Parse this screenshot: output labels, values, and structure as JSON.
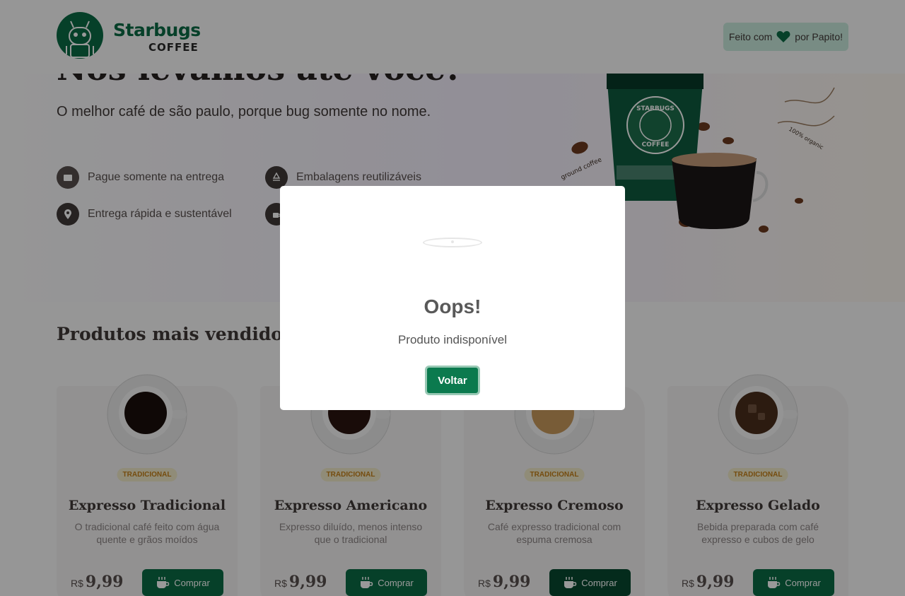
{
  "header": {
    "logo_title": "Starbugs",
    "logo_sub": "COFFEE",
    "made_by_prefix": "Feito com",
    "made_by_suffix": "por Papito!"
  },
  "hero": {
    "title": "Nós levamos até você!",
    "subtitle": "O melhor café de são paulo, porque bug somente no nome.",
    "features": [
      {
        "label": "Pague somente na entrega",
        "icon": "wallet-icon",
        "color": "#574f4d"
      },
      {
        "label": "Embalagens reutilizáveis",
        "icon": "recycle-icon",
        "color": "#403937"
      },
      {
        "label": "Entrega rápida e sustentável",
        "icon": "map-pin-icon",
        "color": "#403937"
      },
      {
        "label": "",
        "icon": "coffee-icon",
        "color": "#403937"
      }
    ],
    "art_labels": {
      "left": "ground coffee",
      "right": "100% organic",
      "cup_line1": "STARBUGS",
      "cup_line2": "COFFEE"
    }
  },
  "products": {
    "title": "Produtos mais vendidos",
    "currency": "R$",
    "buy_label": "Comprar",
    "items": [
      {
        "tag": "TRADICIONAL",
        "name": "Expresso Tradicional",
        "desc": "O tradicional café feito com água quente e grãos moídos",
        "price": "9,99",
        "coffee_color": "#1a0e0a"
      },
      {
        "tag": "TRADICIONAL",
        "name": "Expresso Americano",
        "desc": "Expresso diluído, menos intenso que o tradicional",
        "price": "9,99",
        "coffee_color": "#2a1410"
      },
      {
        "tag": "TRADICIONAL",
        "name": "Expresso Cremoso",
        "desc": "Café expresso tradicional com espuma cremosa",
        "price": "9,99",
        "coffee_color": "#c89a5c"
      },
      {
        "tag": "TRADICIONAL",
        "name": "Expresso Gelado",
        "desc": "Bebida preparada com café expresso e cubos de gelo",
        "price": "9,99",
        "coffee_color": "#4a2e1c"
      }
    ]
  },
  "modal": {
    "title": "Oops!",
    "text": "Produto indisponível",
    "button": "Voltar"
  },
  "colors": {
    "brand": "#0b6b45",
    "overlay": "rgba(0,0,0,0.4)",
    "tag_bg": "#f1e9c9",
    "tag_text": "#c47f17"
  }
}
